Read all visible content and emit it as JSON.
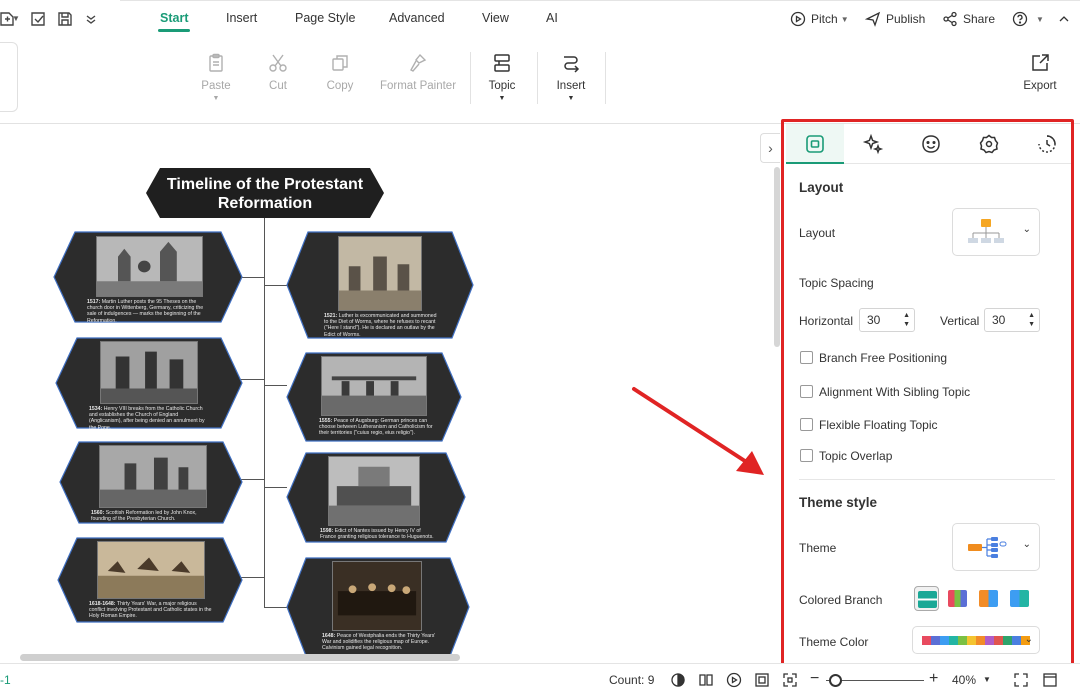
{
  "menu": {
    "tabs": [
      {
        "label": "Start",
        "active": true
      },
      {
        "label": "Insert"
      },
      {
        "label": "Page Style"
      },
      {
        "label": "Advanced"
      },
      {
        "label": "View"
      },
      {
        "label": "AI"
      }
    ],
    "right": {
      "pitch": "Pitch",
      "publish": "Publish",
      "share": "Share"
    }
  },
  "ribbon": {
    "paste": "Paste",
    "cut": "Cut",
    "copy": "Copy",
    "format_painter": "Format Painter",
    "topic": "Topic",
    "insert": "Insert",
    "export": "Export"
  },
  "canvas": {
    "main_topic": "Timeline of the Protestant Reformation",
    "cards": [
      {
        "year": "1517:",
        "text": "Martin Luther posts the 95 Theses on the church door in Wittenberg, Germany, criticizing the sale of indulgences — marks the beginning of the Reformation."
      },
      {
        "year": "1521:",
        "text": "Luther is excommunicated and summoned to the Diet of Worms, where he refuses to recant (\"Here I stand\"). He is declared an outlaw by the Edict of Worms."
      },
      {
        "year": "1534:",
        "text": "Henry VIII breaks from the Catholic Church and establishes the Church of England (Anglicanism), after being denied an annulment by the Pope."
      },
      {
        "year": "1555:",
        "text": "Peace of Augsburg: German princes can choose between Lutheranism and Catholicism for their territories (\"cuius regio, eius religio\")."
      },
      {
        "year": "1560:",
        "text": "Scottish Reformation led by John Knox, founding of the Presbyterian Church."
      },
      {
        "year": "1598:",
        "text": "Edict of Nantes issued by Henry IV of France granting religious tolerance to Huguenots."
      },
      {
        "year": "1618-1648:",
        "text": "Thirty Years' War, a major religious conflict involving Protestant and Catholic states in the Holy Roman Empire."
      },
      {
        "year": "1648:",
        "text": "Peace of Westphalia ends the Thirty Years' War and solidifies the religious map of Europe. Calvinism gained legal recognition."
      }
    ]
  },
  "panel": {
    "layout_section": "Layout",
    "layout_label": "Layout",
    "topic_spacing": "Topic Spacing",
    "horizontal_label": "Horizontal",
    "horizontal_value": "30",
    "vertical_label": "Vertical",
    "vertical_value": "30",
    "options": [
      {
        "label": "Branch Free Positioning",
        "checked": false
      },
      {
        "label": "Alignment With Sibling Topic",
        "checked": false
      },
      {
        "label": "Flexible Floating Topic",
        "checked": false
      },
      {
        "label": "Topic Overlap",
        "checked": false
      }
    ],
    "theme_section": "Theme style",
    "theme_label": "Theme",
    "colored_branch_label": "Colored Branch",
    "theme_color_label": "Theme Color",
    "theme_colors": [
      "#e84a5f",
      "#5b6fd6",
      "#3d9df2",
      "#23b5a4",
      "#7bc043",
      "#f4c430",
      "#f28c28",
      "#b05dc7",
      "#e0554f",
      "#2fa36b",
      "#4a7fe0",
      "#f39c12"
    ],
    "accent_color": "#1a9b77",
    "highlight_color": "#e02424"
  },
  "status": {
    "page": "-1",
    "count": "Count: 9",
    "zoom": "40%"
  }
}
